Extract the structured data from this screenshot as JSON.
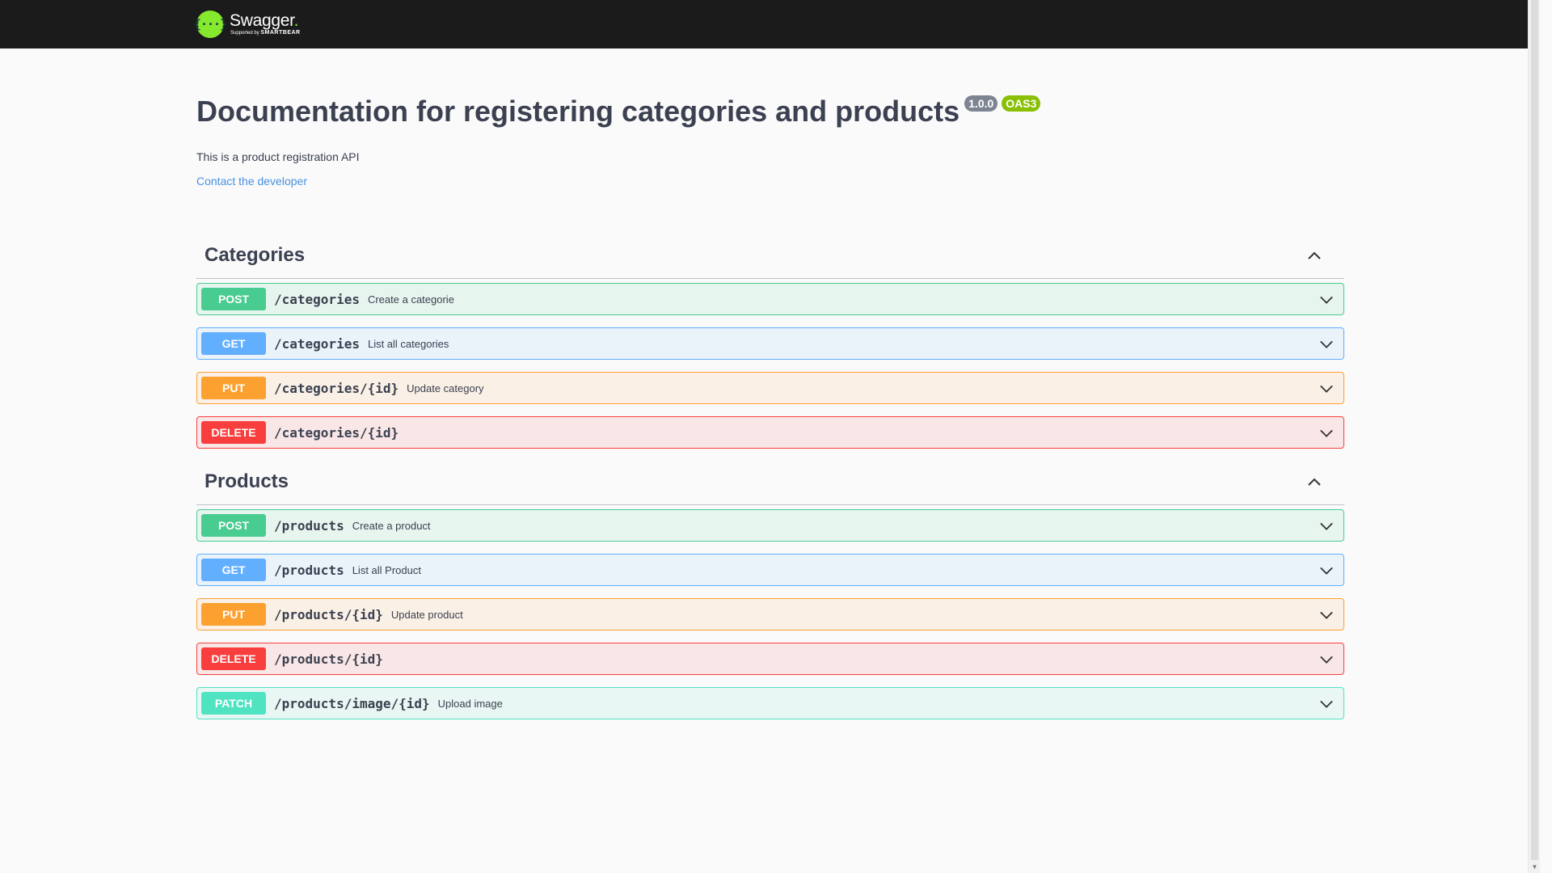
{
  "header": {
    "logo_mark": "{···}",
    "logo_title": "Swagger",
    "logo_sub_prefix": "Supported by",
    "logo_sub_brand": "SMARTBEAR"
  },
  "info": {
    "title": "Documentation for registering categories and products",
    "version": "1.0.0",
    "oas": "OAS3",
    "description": "This is a product registration API",
    "contact": "Contact the developer"
  },
  "tags": [
    {
      "name": "Categories",
      "operations": [
        {
          "method": "POST",
          "path": "/categories",
          "summary": "Create a categorie"
        },
        {
          "method": "GET",
          "path": "/categories",
          "summary": "List all categories"
        },
        {
          "method": "PUT",
          "path": "/categories/{id}",
          "summary": "Update category"
        },
        {
          "method": "DELETE",
          "path": "/categories/{id}",
          "summary": ""
        }
      ]
    },
    {
      "name": "Products",
      "operations": [
        {
          "method": "POST",
          "path": "/products",
          "summary": "Create a product"
        },
        {
          "method": "GET",
          "path": "/products",
          "summary": "List all Product"
        },
        {
          "method": "PUT",
          "path": "/products/{id}",
          "summary": "Update product"
        },
        {
          "method": "DELETE",
          "path": "/products/{id}",
          "summary": ""
        },
        {
          "method": "PATCH",
          "path": "/products/image/{id}",
          "summary": "Upload image"
        }
      ]
    }
  ],
  "colors": {
    "post": "#49cc90",
    "get": "#61affe",
    "put": "#fca130",
    "delete": "#f93e3e",
    "patch": "#50e3c2",
    "link": "#4990e2",
    "topbar": "#1b1b1b",
    "logo_green": "#85ea2d"
  }
}
